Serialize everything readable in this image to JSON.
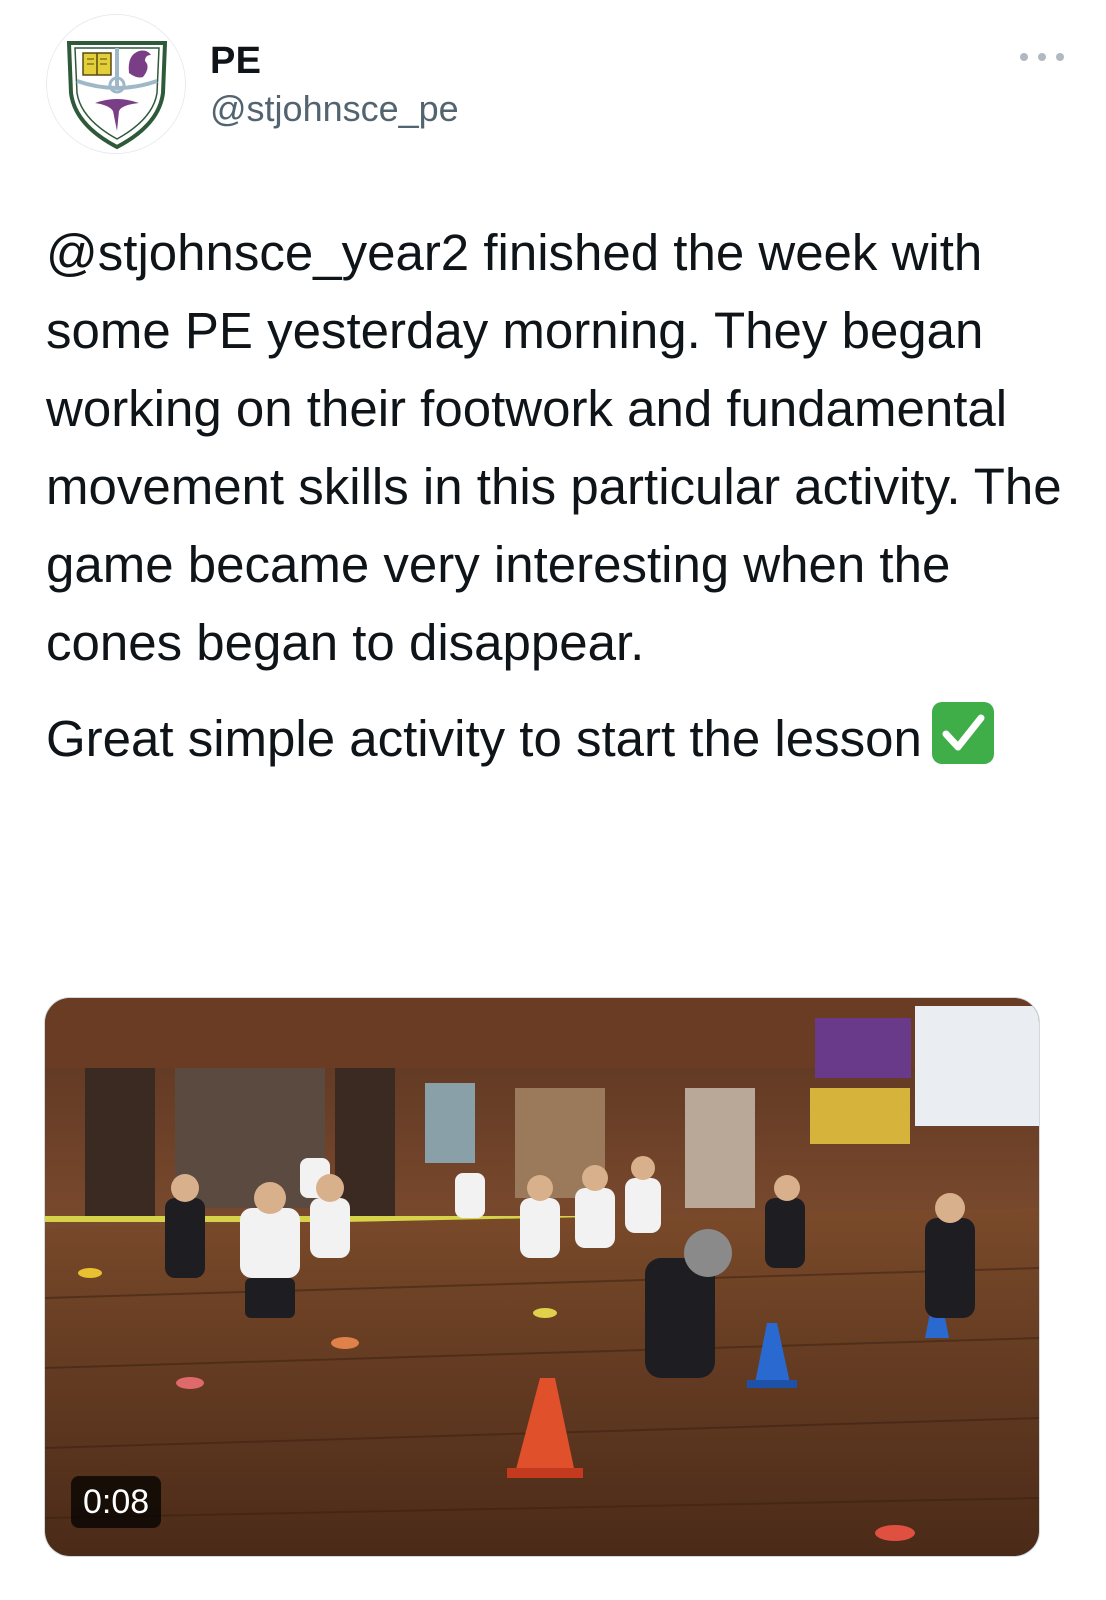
{
  "author": {
    "display_name": "PE",
    "handle": "@stjohnsce_pe",
    "avatar_icon": "school-crest-icon"
  },
  "more_icon": "more-horizontal-icon",
  "tweet": {
    "mention": "@stjohnsce_year2",
    "paragraph1_rest": " finished the week with some PE yesterday morning. They began working on their footwork and fundamental movement skills in this particular activity. The game became very interesting when the cones began to disappear.",
    "paragraph2": "Great simple activity to start the lesson",
    "emoji_icon": "check-mark-button-icon"
  },
  "media": {
    "type": "video",
    "duration": "0:08"
  },
  "colors": {
    "text": "#0f1419",
    "secondary": "#536471",
    "check_green": "#3fae49"
  }
}
